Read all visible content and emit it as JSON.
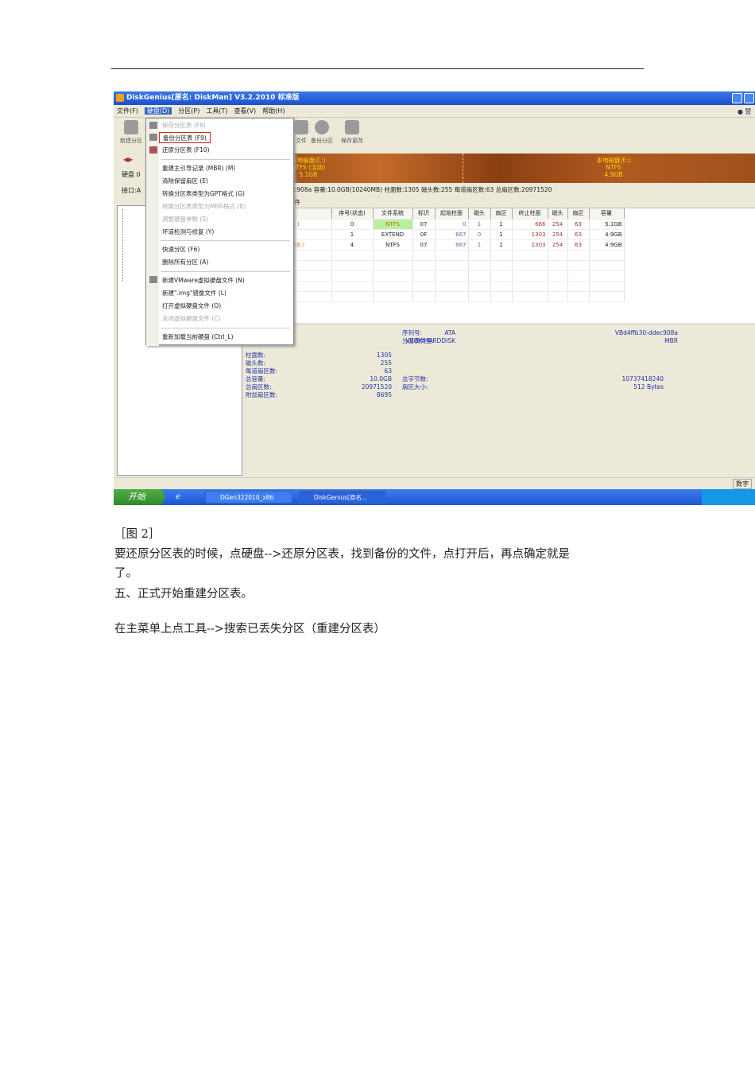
{
  "screenshot": {
    "title": "DiskGenius[原名: DiskMan] V3.2.2010 标准版",
    "menubar": [
      "文件(F)",
      "硬盘(D)",
      "分区(P)",
      "工具(T)",
      "查看(V)",
      "帮助(H)"
    ],
    "menubar_right": "● 赞",
    "toolbar": {
      "new_partition": "新建分区",
      "file": "文件",
      "backup_partition": "备份分区",
      "save_changes": "保存更改"
    },
    "left_labels": {
      "disk": "硬盘 0",
      "interface": "接口:A"
    },
    "dropdown": [
      {
        "label": "保存分区表 (F8)",
        "disabled": true
      },
      {
        "label": "备份分区表 (F9)",
        "highlighted": true
      },
      {
        "label": "还原分区表 (F10)"
      },
      {
        "label": "重建主引导记录 (MBR) (M)"
      },
      {
        "label": "清除保留扇区 (E)"
      },
      {
        "label": "转换分区表类型为GPT格式 (G)"
      },
      {
        "label": "转换分区表类型为MBR格式 (B)",
        "disabled": true
      },
      {
        "label": "调整硬盘参数 (S)",
        "disabled": true
      },
      {
        "label": "坏道检测与修复 (Y)"
      },
      {
        "label": "快速分区 (F6)"
      },
      {
        "label": "删除所有分区 (A)"
      },
      {
        "label": "新建VMware虚拟硬盘文件 (N)"
      },
      {
        "label": "新建\".img\"镜像文件 (L)"
      },
      {
        "label": "打开虚拟硬盘文件 (O)"
      },
      {
        "label": "关闭虚拟硬盘文件 (C)",
        "disabled": true
      },
      {
        "label": "重新加载当前硬盘 (Ctrl_L)"
      }
    ],
    "diskbar": {
      "c": {
        "name": "本地磁盘(C:)",
        "fs": "NTFS (活动)",
        "size": "5.1GB"
      },
      "e": {
        "name": "本地磁盘(E:)",
        "fs": "NTFS",
        "size": "4.9GB"
      }
    },
    "info_line": "...c908a  容量:10.0GB(10240MB)  柱面数:1305  磁头数:255  每道扇区数:63  总扇区数:20971520",
    "tab": "文件",
    "table": {
      "headers": [
        "",
        "序号(状态)",
        "文件系统",
        "标识",
        "起始柱面",
        "磁头",
        "扇区",
        "终止柱面",
        "磁头",
        "扇区",
        "容量"
      ],
      "rows": [
        [
          "(C:)",
          "0",
          "NTFS",
          "07",
          "0",
          "1",
          "1",
          "666",
          "254",
          "63",
          "5.1GB"
        ],
        [
          "",
          "1",
          "EXTEND",
          "0F",
          "667",
          "0",
          "1",
          "1303",
          "254",
          "63",
          "4.9GB"
        ],
        [
          "盘(E:)",
          "4",
          "NTFS",
          "07",
          "667",
          "1",
          "1",
          "1303",
          "254",
          "63",
          "4.9GB"
        ]
      ]
    },
    "details": {
      "model_type": "ATA",
      "model": "VBOX HARDDISK",
      "serial_label": "序列号:",
      "serial": "VBd4ffb30-ddec908a",
      "pt_label": "分区表类型:",
      "pt": "MBR",
      "labels": [
        "柱面数:",
        "磁头数:",
        "每道扇区数:",
        "总容量:",
        "总扇区数:",
        "附加扇区数:"
      ],
      "values": [
        "1305",
        "255",
        "63",
        "10.0GB",
        "20971520",
        "8695"
      ],
      "bytes_label": "总字节数:",
      "bytes": "10737418240",
      "sector_label": "扇区大小:",
      "sector": "512 Bytes"
    },
    "status": "数字",
    "taskbar": {
      "start": "开始",
      "task1": "DGen322010_x86",
      "task2": "DiskGenius[原名..."
    }
  },
  "doc": {
    "caption": "［图 2］",
    "p1a": "要还原分区表的时候，点硬盘-->还原分区表，找到备份的文件，点打开后，再点确定就是",
    "p1b": "了。",
    "p2": "五、正式开始重建分区表。",
    "p3": "在主菜单上点工具-->搜索已丢失分区（重建分区表）"
  }
}
